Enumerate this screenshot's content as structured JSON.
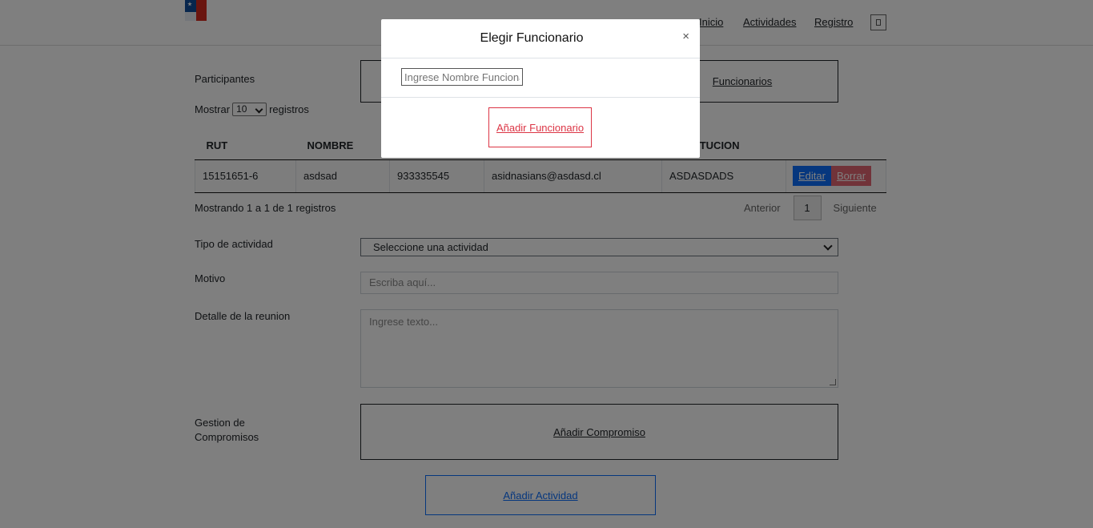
{
  "nav": {
    "links": [
      "Inicio",
      "Actividades",
      "Registro"
    ]
  },
  "participants": {
    "label": "Participantes",
    "funcionarios_link": "Funcionarios",
    "show_prefix": "Mostrar",
    "show_value": "10",
    "show_suffix": "registros"
  },
  "table": {
    "columns": [
      "RUT",
      "NOMBRE",
      "",
      "",
      "INSTITUCION",
      ""
    ],
    "rows": [
      {
        "rut": "15151651-6",
        "nombre": "asdsad",
        "telefono": "933335545",
        "email": "asidnasians@asdasd.cl",
        "institucion": "ASDASDADS"
      }
    ],
    "edit_label": "Editar",
    "delete_label": "Borrar",
    "info": "Mostrando 1 a 1 de 1 registros",
    "pager": {
      "prev": "Anterior",
      "current": "1",
      "next": "Siguiente"
    }
  },
  "form": {
    "tipo_label": "Tipo de actividad",
    "tipo_value": "Seleccione una actividad",
    "motivo_label": "Motivo",
    "motivo_placeholder": "Escriba aquí...",
    "detalle_label": "Detalle de la reunion",
    "detalle_placeholder": "Ingrese texto...",
    "gestion_label_1": "Gestion de",
    "gestion_label_2": "Compromisos",
    "add_compromiso": "Añadir Compromiso",
    "add_actividad": "Añadir Actividad"
  },
  "modal": {
    "title": "Elegir Funcionario",
    "close": "×",
    "input_placeholder": "Ingrese Nombre Funcionario",
    "add_button": "Añadir Funcionario"
  },
  "colors": {
    "primary": "#0d6efd",
    "danger": "#dc3545"
  }
}
